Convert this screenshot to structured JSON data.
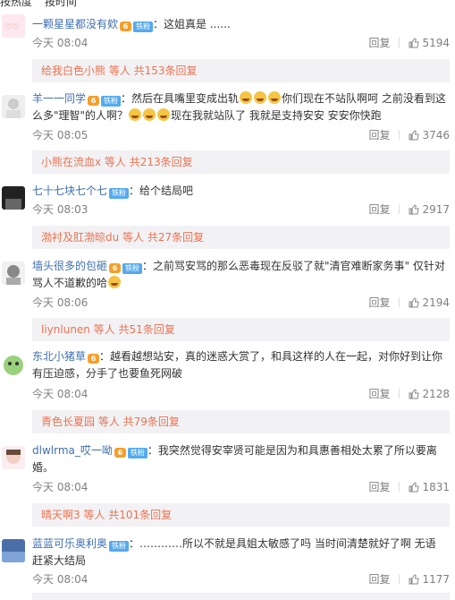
{
  "sort": {
    "hot": "按热度",
    "time": "按时间"
  },
  "comments": [
    {
      "user": "一颗星星都没有欸",
      "badge": "铁粉",
      "text": "这姐真是 ......",
      "time": "今天 08:04",
      "reply_label": "回复",
      "likes": "5194",
      "sub": {
        "who": "给我白色小熊",
        "rest": " 等人 共153条回复"
      }
    },
    {
      "user": "羊一一同学",
      "badge": "铁粉",
      "text_a": "然后在具嘴里变成出轨",
      "text_b": "你们现在不站队啊呵 之前没看到这么多\"理智\"的人啊？",
      "text_c": "现在我就站队了 我就是支持安安 安安你快跑",
      "time": "今天 08:05",
      "reply_label": "回复",
      "likes": "3746",
      "sub": {
        "who": "小熊在流血x",
        "rest": " 等人 共213条回复"
      }
    },
    {
      "user": "七十七块七个七",
      "badge": "铁粉",
      "text": "给个结局吧",
      "time": "今天 08:03",
      "reply_label": "回复",
      "likes": "2917",
      "sub": {
        "who": "渤衬及肛渤晾du",
        "rest": " 等人 共27条回复"
      }
    },
    {
      "user": "墙头很多的包砸",
      "badge": "铁粉",
      "text": "之前骂安骂的那么恶毒现在反驳了就\"清官难断家务事\" 仅针对骂人不道歉的哈",
      "time": "今天 08:06",
      "reply_label": "回复",
      "likes": "2194",
      "sub": {
        "who": "liynlunen",
        "rest": " 等人 共51条回复"
      }
    },
    {
      "user": "东北小猪草",
      "badge": "",
      "text": "越看越想站安，真的迷惑大赏了，和具这样的人在一起，对你好到让你有压迫感，分手了也要鱼死网破",
      "time": "今天 08:04",
      "reply_label": "回复",
      "likes": "2128",
      "sub": {
        "who": "青色长夏园",
        "rest": " 等人 共79条回复"
      }
    },
    {
      "user": "dlwlrma_哎一呦",
      "badge": "铁粉",
      "text": "我突然觉得安宰贤可能是因为和具惠善相处太累了所以要离婚。",
      "time": "今天 08:04",
      "reply_label": "回复",
      "likes": "1831",
      "sub": {
        "who": "晴天啊3",
        "rest": " 等人 共101条回复"
      }
    },
    {
      "user": "蓝蓝可乐奥利奥",
      "badge": "铁粉",
      "text": "…………所以不就是具姐太敏感了吗 当时间清楚就好了啊  无语  赶紧大结局",
      "time": "今天 08:04",
      "reply_label": "回复",
      "likes": "1177"
    }
  ],
  "colors": {
    "accent": "#eb7350",
    "meta": "#808080",
    "reply_bg": "#f2f2f5"
  }
}
